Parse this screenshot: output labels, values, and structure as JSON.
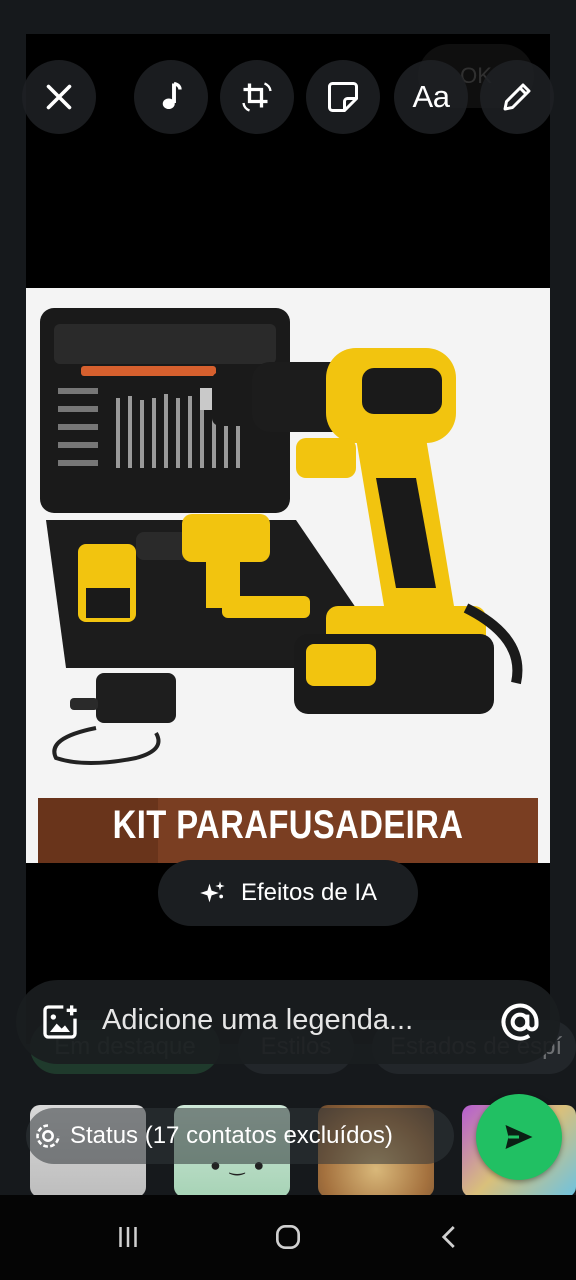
{
  "toolbar": {
    "close_icon": "close-icon",
    "music_icon": "music-note-icon",
    "crop_icon": "crop-rotate-icon",
    "sticker_icon": "sticker-icon",
    "text_label": "Aa",
    "draw_icon": "pencil-icon"
  },
  "ghost_header": {
    "ok_label": "OK"
  },
  "image": {
    "banner_text": "KIT PARAFUSADEIRA"
  },
  "ai_effects": {
    "label": "Efeitos de IA",
    "icon": "sparkle-icon"
  },
  "filters": {
    "chips": [
      "Em destaque",
      "Estilos",
      "Estados de espí"
    ]
  },
  "caption": {
    "placeholder": "Adicione uma legenda...",
    "add_image_icon": "add-image-icon",
    "mention_icon": "at-icon"
  },
  "status": {
    "label": "Status (17 contatos excluídos)",
    "icon": "status-ring-icon"
  },
  "send": {
    "icon": "send-icon",
    "color": "#21C063"
  },
  "navbar": {
    "recents_icon": "recents-icon",
    "home_icon": "home-icon",
    "back_icon": "back-icon"
  },
  "colors": {
    "accent": "#21C063",
    "drill_yellow": "#F2C40F",
    "background": "#000000"
  }
}
